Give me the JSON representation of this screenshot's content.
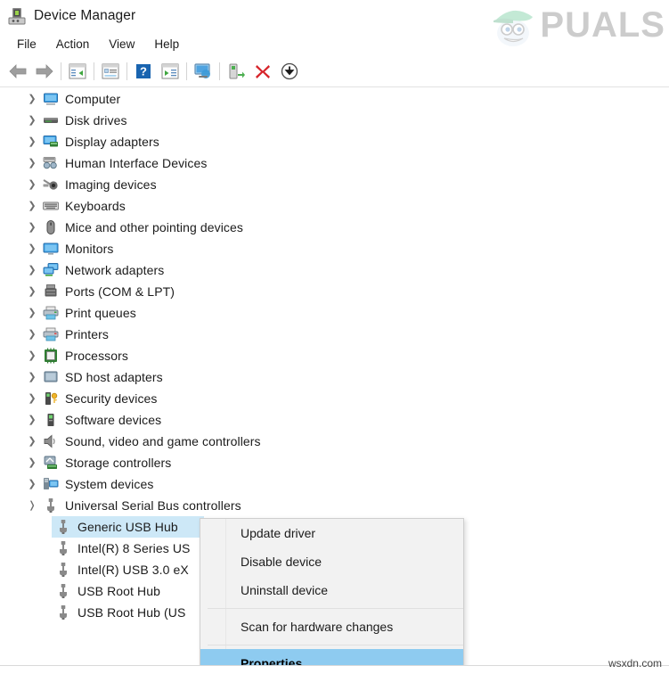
{
  "window": {
    "title": "Device Manager",
    "icon": "device-manager-icon"
  },
  "menubar": {
    "items": [
      {
        "label": "File",
        "name": "menu-file"
      },
      {
        "label": "Action",
        "name": "menu-action"
      },
      {
        "label": "View",
        "name": "menu-view"
      },
      {
        "label": "Help",
        "name": "menu-help"
      }
    ]
  },
  "toolbar": {
    "buttons": [
      {
        "name": "back-icon",
        "tip": "Back"
      },
      {
        "name": "forward-icon",
        "tip": "Forward"
      },
      {
        "name": "show-hide-console-tree-icon",
        "tip": "Show/Hide Console Tree"
      },
      {
        "name": "properties-icon",
        "tip": "Properties"
      },
      {
        "name": "help-icon",
        "tip": "Help"
      },
      {
        "name": "show-hidden-devices-icon",
        "tip": "Show hidden devices"
      },
      {
        "name": "scan-for-hardware-changes-icon",
        "tip": "Scan for hardware changes"
      },
      {
        "name": "update-driver-icon",
        "tip": "Update driver"
      },
      {
        "name": "uninstall-device-icon",
        "tip": "Uninstall device"
      },
      {
        "name": "disable-device-icon",
        "tip": "Disable device"
      }
    ]
  },
  "tree": {
    "items": [
      {
        "label": "Computer",
        "icon": "computer-icon",
        "depth": 1,
        "expandable": true,
        "expanded": false,
        "selected": false
      },
      {
        "label": "Disk drives",
        "icon": "disk-drive-icon",
        "depth": 1,
        "expandable": true,
        "expanded": false,
        "selected": false
      },
      {
        "label": "Display adapters",
        "icon": "display-adapter-icon",
        "depth": 1,
        "expandable": true,
        "expanded": false,
        "selected": false
      },
      {
        "label": "Human Interface Devices",
        "icon": "hid-icon",
        "depth": 1,
        "expandable": true,
        "expanded": false,
        "selected": false
      },
      {
        "label": "Imaging devices",
        "icon": "imaging-device-icon",
        "depth": 1,
        "expandable": true,
        "expanded": false,
        "selected": false
      },
      {
        "label": "Keyboards",
        "icon": "keyboard-icon",
        "depth": 1,
        "expandable": true,
        "expanded": false,
        "selected": false
      },
      {
        "label": "Mice and other pointing devices",
        "icon": "mouse-icon",
        "depth": 1,
        "expandable": true,
        "expanded": false,
        "selected": false
      },
      {
        "label": "Monitors",
        "icon": "monitor-icon",
        "depth": 1,
        "expandable": true,
        "expanded": false,
        "selected": false
      },
      {
        "label": "Network adapters",
        "icon": "network-adapter-icon",
        "depth": 1,
        "expandable": true,
        "expanded": false,
        "selected": false
      },
      {
        "label": "Ports (COM & LPT)",
        "icon": "port-icon",
        "depth": 1,
        "expandable": true,
        "expanded": false,
        "selected": false
      },
      {
        "label": "Print queues",
        "icon": "print-queue-icon",
        "depth": 1,
        "expandable": true,
        "expanded": false,
        "selected": false
      },
      {
        "label": "Printers",
        "icon": "printer-icon",
        "depth": 1,
        "expandable": true,
        "expanded": false,
        "selected": false
      },
      {
        "label": "Processors",
        "icon": "processor-icon",
        "depth": 1,
        "expandable": true,
        "expanded": false,
        "selected": false
      },
      {
        "label": "SD host adapters",
        "icon": "sd-host-adapter-icon",
        "depth": 1,
        "expandable": true,
        "expanded": false,
        "selected": false
      },
      {
        "label": "Security devices",
        "icon": "security-device-icon",
        "depth": 1,
        "expandable": true,
        "expanded": false,
        "selected": false
      },
      {
        "label": "Software devices",
        "icon": "software-device-icon",
        "depth": 1,
        "expandable": true,
        "expanded": false,
        "selected": false
      },
      {
        "label": "Sound, video and game controllers",
        "icon": "sound-controller-icon",
        "depth": 1,
        "expandable": true,
        "expanded": false,
        "selected": false
      },
      {
        "label": "Storage controllers",
        "icon": "storage-controller-icon",
        "depth": 1,
        "expandable": true,
        "expanded": false,
        "selected": false
      },
      {
        "label": "System devices",
        "icon": "system-device-icon",
        "depth": 1,
        "expandable": true,
        "expanded": false,
        "selected": false
      },
      {
        "label": "Universal Serial Bus controllers",
        "icon": "usb-icon",
        "depth": 1,
        "expandable": true,
        "expanded": true,
        "selected": false
      },
      {
        "label": "Generic USB Hub",
        "icon": "usb-icon",
        "depth": 2,
        "expandable": false,
        "expanded": false,
        "selected": true
      },
      {
        "label": "Intel(R) 8 Series US",
        "icon": "usb-icon",
        "depth": 2,
        "expandable": false,
        "expanded": false,
        "selected": false
      },
      {
        "label": "Intel(R) USB 3.0 eX",
        "icon": "usb-icon",
        "depth": 2,
        "expandable": false,
        "expanded": false,
        "selected": false
      },
      {
        "label": "USB Root Hub",
        "icon": "usb-icon",
        "depth": 2,
        "expandable": false,
        "expanded": false,
        "selected": false
      },
      {
        "label": "USB Root Hub (US",
        "icon": "usb-icon",
        "depth": 2,
        "expandable": false,
        "expanded": false,
        "selected": false
      }
    ]
  },
  "context_menu": {
    "items": [
      {
        "label": "Update driver",
        "name": "ctx-update-driver",
        "active": false,
        "separator_after": false
      },
      {
        "label": "Disable device",
        "name": "ctx-disable-device",
        "active": false,
        "separator_after": false
      },
      {
        "label": "Uninstall device",
        "name": "ctx-uninstall-device",
        "active": false,
        "separator_after": true
      },
      {
        "label": "Scan for hardware changes",
        "name": "ctx-scan-hardware-changes",
        "active": false,
        "separator_after": true
      },
      {
        "label": "Properties",
        "name": "ctx-properties",
        "active": true,
        "separator_after": false
      }
    ]
  },
  "watermarks": {
    "appuals": "PUALS",
    "site": "wsxdn.com"
  },
  "colors": {
    "selection_tree": "#cde8f7",
    "selection_menu": "#8ecbf0",
    "text": "#1b1b1b",
    "menu_bg": "#f2f2f2"
  }
}
